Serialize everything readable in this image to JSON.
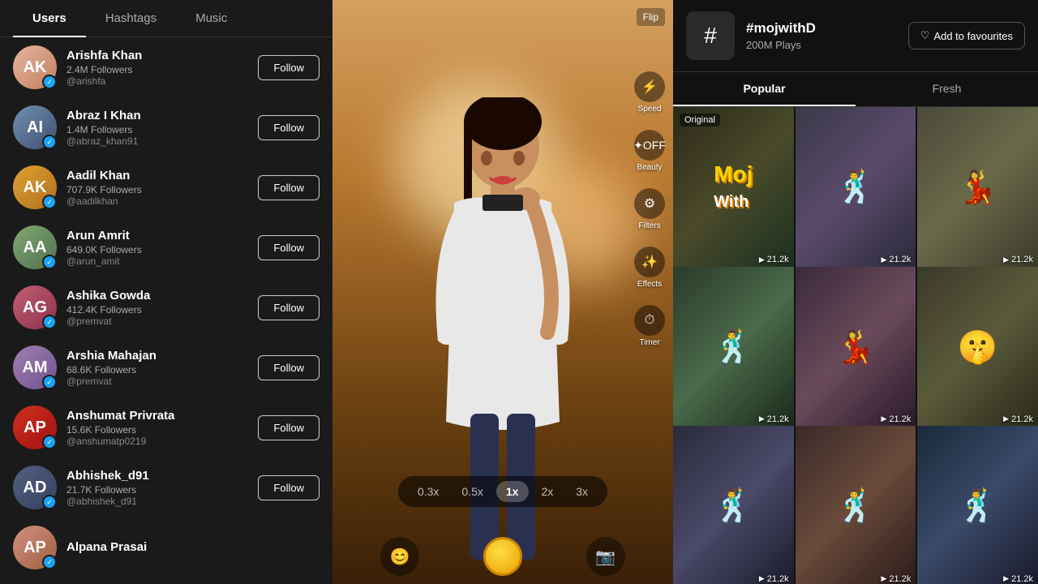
{
  "tabs": {
    "items": [
      {
        "label": "Users",
        "active": true
      },
      {
        "label": "Hashtags",
        "active": false
      },
      {
        "label": "Music",
        "active": false
      }
    ]
  },
  "users": [
    {
      "name": "Arishfa Khan",
      "followers": "2.4M Followers",
      "handle": "@arishfa",
      "avatarClass": "u1",
      "initials": "AK"
    },
    {
      "name": "Abraz I Khan",
      "followers": "1.4M Followers",
      "handle": "@abraz_khan91",
      "avatarClass": "u2",
      "initials": "AI"
    },
    {
      "name": "Aadil Khan",
      "followers": "707.9K Followers",
      "handle": "@aadilkhan",
      "avatarClass": "u3",
      "initials": "AK"
    },
    {
      "name": "Arun Amrit",
      "followers": "649.0K Followers",
      "handle": "@arun_amit",
      "avatarClass": "u4",
      "initials": "AA"
    },
    {
      "name": "Ashika Gowda",
      "followers": "412.4K Followers",
      "handle": "@premvat",
      "avatarClass": "u5",
      "initials": "AG"
    },
    {
      "name": "Arshia Mahajan",
      "followers": "68.6K Followers",
      "handle": "@premvat",
      "avatarClass": "u6",
      "initials": "AM"
    },
    {
      "name": "Anshumat Privrata",
      "followers": "15.6K Followers",
      "handle": "@anshumatp0219",
      "avatarClass": "u7",
      "initials": "AP"
    },
    {
      "name": "Abhishek_d91",
      "followers": "21.7K Followers",
      "handle": "@abhishek_d91",
      "avatarClass": "u8",
      "initials": "AD"
    },
    {
      "name": "Alpana Prasai",
      "followers": "",
      "handle": "",
      "avatarClass": "u9",
      "initials": "AP"
    }
  ],
  "follow_label": "Follow",
  "video": {
    "flip_label": "Flip",
    "speed_label": "Speed",
    "beauty_label": "Beauty",
    "filters_label": "Filters",
    "effects_label": "Effects",
    "timer_label": "Timer",
    "speed_options": [
      "0.3x",
      "0.5x",
      "1x",
      "2x",
      "3x"
    ],
    "active_speed": "1x"
  },
  "hashtag": {
    "name": "#mojwithD",
    "plays": "200M Plays",
    "fav_label": "Add to favourites"
  },
  "popular_tabs": [
    {
      "label": "Popular",
      "active": true
    },
    {
      "label": "Fresh",
      "active": false
    }
  ],
  "grid_items": [
    {
      "label": "Original",
      "count": "21.2k",
      "thumbClass": "gt1",
      "showMoj": true
    },
    {
      "label": "",
      "count": "21.2k",
      "thumbClass": "gt2",
      "showMoj": false
    },
    {
      "label": "",
      "count": "21.2k",
      "thumbClass": "gt3",
      "showMoj": false
    },
    {
      "label": "",
      "count": "21.2k",
      "thumbClass": "gt4",
      "showMoj": false
    },
    {
      "label": "",
      "count": "21.2k",
      "thumbClass": "gt5",
      "showMoj": false
    },
    {
      "label": "",
      "count": "21.2k",
      "thumbClass": "gt6",
      "showMoj": false
    },
    {
      "label": "",
      "count": "21.2k",
      "thumbClass": "gt7",
      "showMoj": false
    },
    {
      "label": "",
      "count": "21.2k",
      "thumbClass": "gt8",
      "showMoj": false
    },
    {
      "label": "",
      "count": "21.2k",
      "thumbClass": "gt9",
      "showMoj": false
    }
  ]
}
